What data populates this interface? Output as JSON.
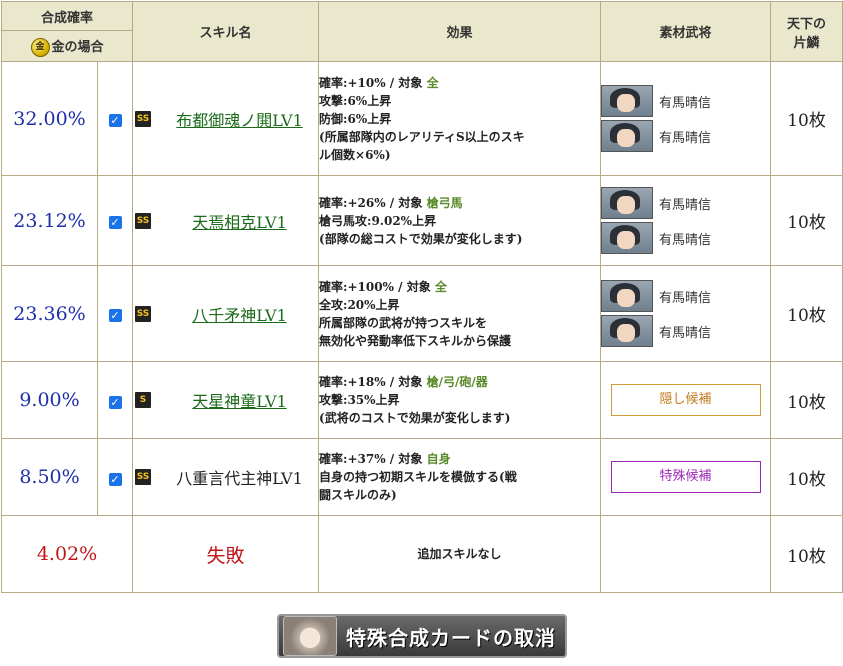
{
  "header": {
    "rate": "合成確率",
    "gold_case": "金の場合",
    "gold_icon": "gold-coin-icon",
    "skill_name": "スキル名",
    "effect": "効果",
    "material": "素材武将",
    "shard_line1": "天下の",
    "shard_line2": "片鱗"
  },
  "rows": [
    {
      "rate": "32.00%",
      "rank": "SS",
      "skill": "布都御魂ノ閧LV1",
      "linked": true,
      "effect": {
        "rate": "確率:+10%",
        "target_label": "対象",
        "target": "全",
        "lines": [
          "攻撃:6%上昇",
          "防御:6%上昇",
          "(所属部隊内のレアリティS以上のスキ",
          "ル個数×6%)"
        ]
      },
      "materials": [
        "有馬晴信",
        "有馬晴信"
      ],
      "count": "10枚"
    },
    {
      "rate": "23.12%",
      "rank": "SS",
      "skill": "天焉相克LV1",
      "linked": true,
      "effect": {
        "rate": "確率:+26%",
        "target_label": "対象",
        "target": "槍弓馬",
        "lines": [
          "槍弓馬攻:9.02%上昇",
          "(部隊の総コストで効果が変化します)"
        ]
      },
      "materials": [
        "有馬晴信",
        "有馬晴信"
      ],
      "count": "10枚"
    },
    {
      "rate": "23.36%",
      "rank": "SS",
      "skill": "八千矛神LV1",
      "linked": true,
      "effect": {
        "rate": "確率:+100%",
        "target_label": "対象",
        "target": "全",
        "lines": [
          "全攻:20%上昇",
          "所属部隊の武将が持つスキルを",
          "無効化や発動率低下スキルから保護"
        ]
      },
      "materials": [
        "有馬晴信",
        "有馬晴信"
      ],
      "count": "10枚"
    },
    {
      "rate": "9.00%",
      "rank": "S",
      "skill": "天星神童LV1",
      "linked": true,
      "effect": {
        "rate": "確率:+18%",
        "target_label": "対象",
        "target": "槍/弓/砲/器",
        "lines": [
          "攻撃:35%上昇",
          "(武将のコストで効果が変化します)"
        ]
      },
      "candidate": "隠し候補",
      "candidate_type": "hidden",
      "count": "10枚"
    },
    {
      "rate": "8.50%",
      "rank": "SS",
      "skill": "八重言代主神LV1",
      "linked": false,
      "effect": {
        "rate": "確率:+37%",
        "target_label": "対象",
        "target": "自身",
        "lines": [
          "自身の持つ初期スキルを模倣する(戦",
          "闘スキルのみ)"
        ]
      },
      "candidate": "特殊候補",
      "candidate_type": "special",
      "count": "10枚"
    }
  ],
  "fail_row": {
    "rate": "4.02%",
    "label": "失敗",
    "effect": "追加スキルなし",
    "count": "10枚"
  },
  "cancel_button": {
    "label": "特殊合成カードの取消"
  },
  "colors": {
    "header_bg": "#eae8cc",
    "rate_blue": "#1f2fa8",
    "fail_red": "#c0161b",
    "skill_green": "#1a6a1a",
    "hidden_orange": "#c07a1a",
    "special_purple": "#9c29b6"
  }
}
